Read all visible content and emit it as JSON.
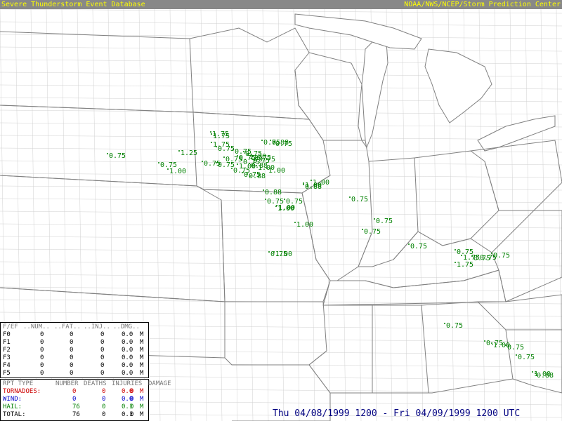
{
  "header": {
    "left_title": "Severe Thunderstorm Event Database",
    "right_title": "NOAA/NWS/NCEP/Storm Prediction Center"
  },
  "colors": {
    "header_bg": "#888888",
    "header_text": "#ffff00",
    "hail": "#008000",
    "tornado": "#cc0000",
    "wind": "#0000cc",
    "date_text": "#000080",
    "map_lines": "#808080"
  },
  "fscale_table": {
    "headers": [
      "F/EF",
      "..NUM..",
      "..FAT..",
      "..INJ..",
      "..DMG.."
    ],
    "rows": [
      {
        "scale": "F0",
        "num": "0",
        "fat": "0",
        "inj": "0",
        "dmg": "0.0",
        "unit": "M"
      },
      {
        "scale": "F1",
        "num": "0",
        "fat": "0",
        "inj": "0",
        "dmg": "0.0",
        "unit": "M"
      },
      {
        "scale": "F2",
        "num": "0",
        "fat": "0",
        "inj": "0",
        "dmg": "0.0",
        "unit": "M"
      },
      {
        "scale": "F3",
        "num": "0",
        "fat": "0",
        "inj": "0",
        "dmg": "0.0",
        "unit": "M"
      },
      {
        "scale": "F4",
        "num": "0",
        "fat": "0",
        "inj": "0",
        "dmg": "0.0",
        "unit": "M"
      },
      {
        "scale": "F5",
        "num": "0",
        "fat": "0",
        "inj": "0",
        "dmg": "0.0",
        "unit": "M"
      }
    ]
  },
  "report_table": {
    "headers": [
      "RPT TYPE",
      "NUMBER",
      "DEATHS",
      "INJURIES",
      "DAMAGE"
    ],
    "rows": [
      {
        "type": "TORNADOES:",
        "number": "0",
        "deaths": "0",
        "injuries": "0",
        "damage": "0.0",
        "unit": "M",
        "color": "#cc0000"
      },
      {
        "type": "WIND:",
        "number": "0",
        "deaths": "0",
        "injuries": "0",
        "damage": "0.0",
        "unit": "M",
        "color": "#0000cc"
      },
      {
        "type": "HAIL:",
        "number": "76",
        "deaths": "0",
        "injuries": "0",
        "damage": "0.1",
        "unit": "M",
        "color": "#008000"
      },
      {
        "type": "TOTAL:",
        "number": "76",
        "deaths": "0",
        "injuries": "0",
        "damage": "0.1",
        "unit": "M",
        "color": "#000000"
      }
    ]
  },
  "date_range": "Thu 04/08/1999 1200 - Fri 04/09/1999 1200 UTC",
  "hail_reports": [
    "1.75",
    "1.75",
    "0.75",
    "1.25",
    "0.75",
    "0.75",
    "1.00",
    "0.75",
    "0.75",
    "0.75",
    "0.75",
    "1.00",
    "0.75",
    "0.75",
    "0.88",
    "1.00",
    "0.75",
    "1.00",
    "0.75",
    "0.75",
    "0.88",
    "0.75",
    "0.88",
    "1.00",
    "0.75",
    "0.75",
    "0.75",
    "0.75",
    "1.75",
    "1.00",
    "1.00",
    "0.88",
    "1.00",
    "1.00",
    "0.88",
    "0.75",
    "1.00",
    "0.75",
    "0.75",
    "1.00",
    "0.75",
    "0.75",
    "0.75",
    "0.75",
    "0.75",
    "1.75",
    "1.75",
    "0.75",
    "0.75",
    "0.75",
    "0.75",
    "0.75",
    "1.00",
    "0.75",
    "0.75",
    "1.00",
    "0.88"
  ]
}
